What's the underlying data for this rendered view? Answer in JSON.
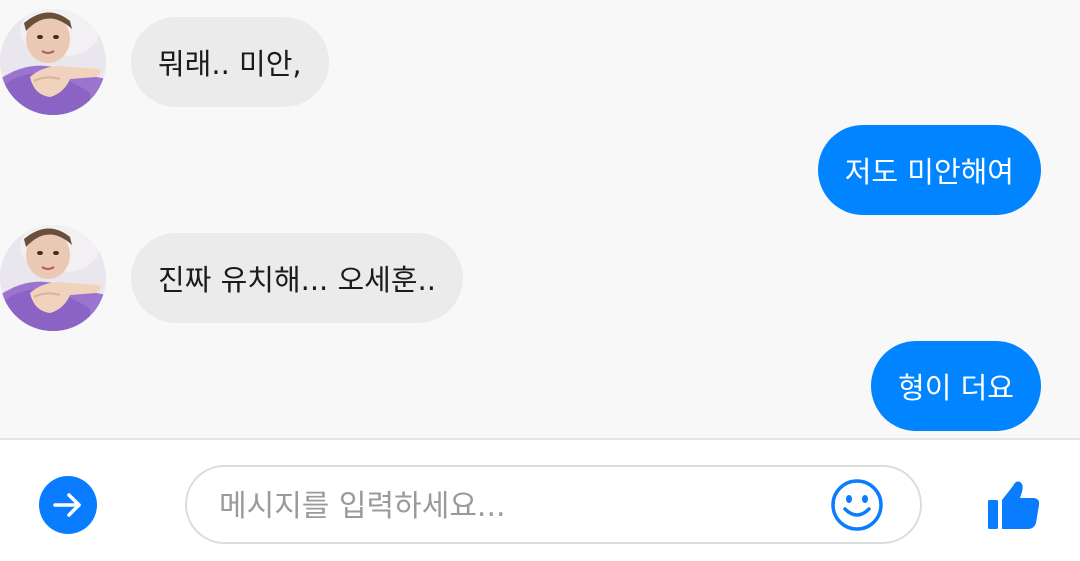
{
  "messages": [
    {
      "direction": "incoming",
      "text": "뭐래.. 미안,"
    },
    {
      "direction": "outgoing",
      "text": "저도 미안해여"
    },
    {
      "direction": "incoming",
      "text": "진짜 유치해... 오세훈.."
    },
    {
      "direction": "outgoing",
      "text": "형이 더요"
    }
  ],
  "composer": {
    "placeholder": "메시지를 입력하세요...",
    "send_icon": "arrow-right-circle-icon",
    "emoji_icon": "smiley-icon",
    "like_icon": "thumbs-up-icon"
  },
  "colors": {
    "accent": "#0084ff",
    "incoming_bubble": "#ebebeb",
    "chat_background": "#f8f8f8"
  }
}
